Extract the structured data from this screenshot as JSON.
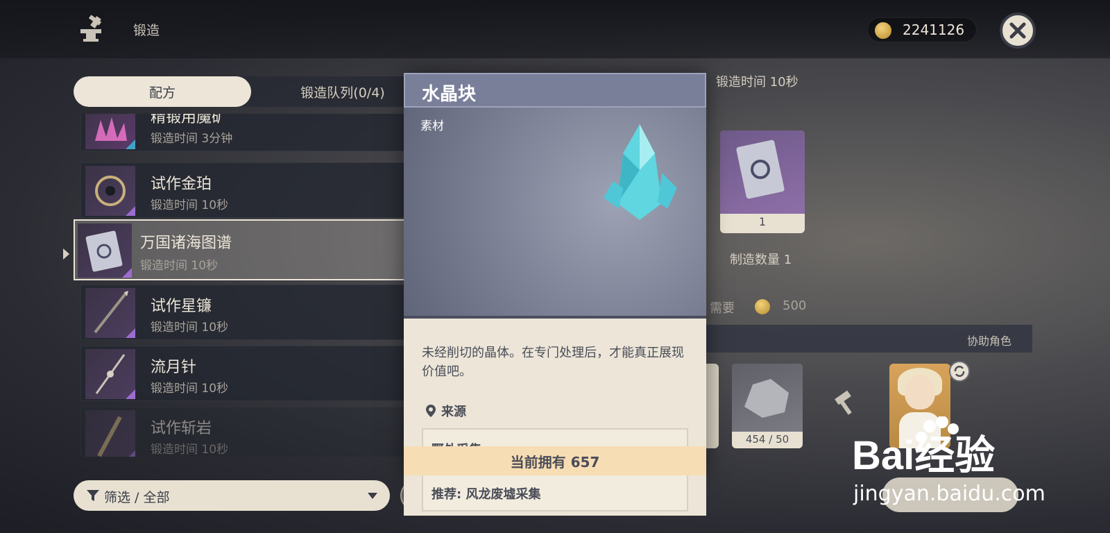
{
  "header": {
    "title": "锻造",
    "mora": "2241126"
  },
  "tabs": {
    "recipes": "配方",
    "queue": "锻造队列(0/4)"
  },
  "list": {
    "items": [
      {
        "name": "精锻用魔矿",
        "time": "锻造时间 3分钟"
      },
      {
        "name": "试作金珀",
        "time": "锻造时间 10秒"
      },
      {
        "name": "万国诸海图谱",
        "time": "锻造时间 10秒"
      },
      {
        "name": "试作星镰",
        "time": "锻造时间 10秒"
      },
      {
        "name": "流月针",
        "time": "锻造时间 10秒"
      },
      {
        "name": "试作斩岩",
        "time": "锻造时间 10秒"
      }
    ]
  },
  "filter": {
    "label": "筛选 / 全部"
  },
  "right_panel": {
    "time": "锻造时间 10秒",
    "product_count": "1",
    "quantity_label": "制造数量 1",
    "need_label": "需要",
    "cost": "500",
    "assist_label": "协助角色",
    "material_count": "454 / 50"
  },
  "popup": {
    "name": "水晶块",
    "type": "素材",
    "description": "未经削切的晶体。在专门处理后，才能真正展现价值吧。",
    "source_label": "来源",
    "sources": [
      "野外采集",
      "推荐: 风龙废墟采集"
    ],
    "owned": "当前拥有 657"
  },
  "watermark": {
    "url": "jingyan.baidu.com",
    "brand": "Bai经验"
  },
  "colors": {
    "accent_cream": "#ece5d8",
    "rarity_purple": "#9d6ccf",
    "popup_header": "#7a7f99",
    "crystal": "#5fd6e0"
  }
}
